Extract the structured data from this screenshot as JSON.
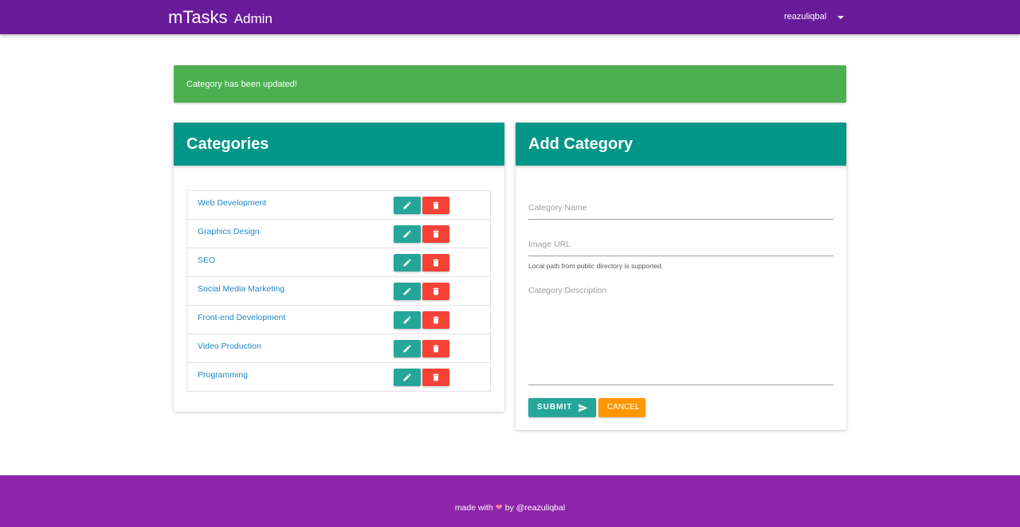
{
  "header": {
    "brand": "mTasks",
    "brand_sub": "Admin",
    "username": "reazuliqbal"
  },
  "alert": {
    "message": "Category has been updated!"
  },
  "categories_card": {
    "title": "Categories",
    "items": [
      {
        "name": "Web Development"
      },
      {
        "name": "Graphics Design"
      },
      {
        "name": "SEO"
      },
      {
        "name": "Social Media Marketing"
      },
      {
        "name": "Front-end Development"
      },
      {
        "name": "Video Production"
      },
      {
        "name": "Programming"
      }
    ]
  },
  "add_card": {
    "title": "Add Category",
    "fields": {
      "name_label": "Category Name",
      "image_label": "Image URL",
      "image_helper": "Local path from public directory is supported.",
      "description_label": "Category Description"
    },
    "submit_label": "SUBMIT",
    "cancel_label": "CANCEL"
  },
  "footer": {
    "text_before": "made with",
    "text_after": "by @reazuliqbal"
  },
  "icons": {
    "edit": "pencil-icon",
    "delete": "trash-icon",
    "submit": "send-icon",
    "dropdown": "caret-down-icon",
    "heart": "heart-icon"
  },
  "colors": {
    "header": "#6a1b9a",
    "footer": "#8e24aa",
    "alert": "#4caf50",
    "card_header": "#009688",
    "edit_button": "#26a69a",
    "delete_button": "#f44336",
    "cancel_button": "#ff9800",
    "link": "#1e88c7"
  }
}
